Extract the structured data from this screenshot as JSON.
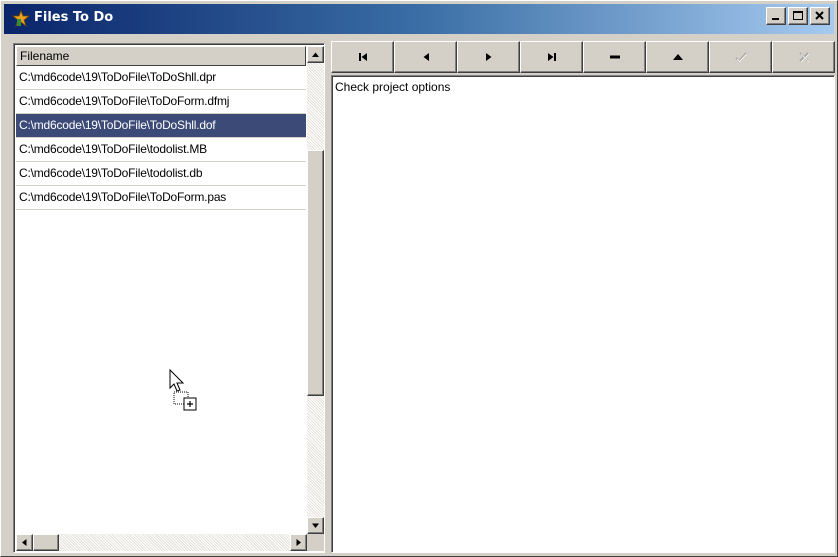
{
  "window": {
    "title": "Files To Do",
    "icon": "app-icon",
    "caption_buttons": [
      "minimize-icon",
      "maximize-icon",
      "close-icon"
    ]
  },
  "file_list": {
    "header": "Filename",
    "rows": [
      {
        "name": "C:\\md6code\\19\\ToDoFile\\ToDoShll.dpr",
        "selected": false
      },
      {
        "name": "C:\\md6code\\19\\ToDoFile\\ToDoForm.dfmj",
        "selected": false
      },
      {
        "name": "C:\\md6code\\19\\ToDoFile\\ToDoShll.dof",
        "selected": true
      },
      {
        "name": "C:\\md6code\\19\\ToDoFile\\todolist.MB",
        "selected": false
      },
      {
        "name": "C:\\md6code\\19\\ToDoFile\\todolist.db",
        "selected": false
      },
      {
        "name": "C:\\md6code\\19\\ToDoFile\\ToDoForm.pas",
        "selected": false
      }
    ]
  },
  "navigator": {
    "buttons": [
      {
        "icon": "first-record-icon",
        "enabled": true
      },
      {
        "icon": "prior-record-icon",
        "enabled": true
      },
      {
        "icon": "next-record-icon",
        "enabled": true
      },
      {
        "icon": "last-record-icon",
        "enabled": true
      },
      {
        "icon": "delete-record-icon",
        "enabled": true
      },
      {
        "icon": "edit-record-icon",
        "enabled": true
      },
      {
        "icon": "post-record-icon",
        "enabled": false
      },
      {
        "icon": "cancel-record-icon",
        "enabled": false
      }
    ]
  },
  "memo": {
    "text": "Check project options"
  },
  "cursor": {
    "icon": "drag-copy-cursor-icon"
  }
}
